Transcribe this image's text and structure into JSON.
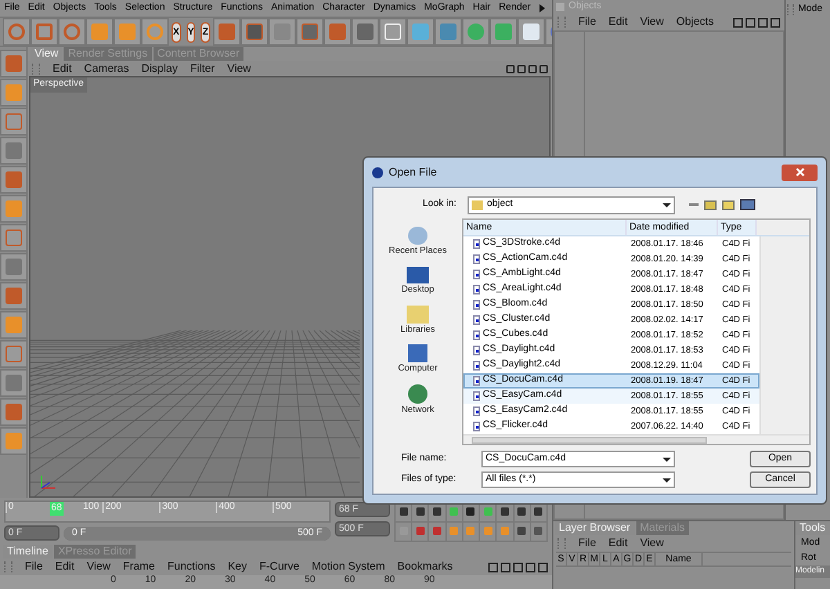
{
  "menubar": [
    "File",
    "Edit",
    "Objects",
    "Tools",
    "Selection",
    "Structure",
    "Functions",
    "Animation",
    "Character",
    "Dynamics",
    "MoGraph",
    "Hair",
    "Render"
  ],
  "axis_buttons": [
    "X",
    "Y",
    "Z"
  ],
  "view_tabs": [
    {
      "label": "View",
      "selected": true
    },
    {
      "label": "Render Settings",
      "selected": false
    },
    {
      "label": "Content Browser",
      "selected": false
    }
  ],
  "view_menu": [
    "Edit",
    "Cameras",
    "Display",
    "Filter",
    "View"
  ],
  "viewport_label": "Perspective",
  "objects_panel": {
    "title": "Objects",
    "menu": [
      "File",
      "Edit",
      "View",
      "Objects"
    ]
  },
  "attributes_panel": {
    "mode": "Mode"
  },
  "timeline_ruler": {
    "ticks": [
      "0",
      "100",
      "200",
      "300",
      "400",
      "500"
    ],
    "current": "68"
  },
  "range_slider": {
    "level": 1
  },
  "current_frame": "68 F",
  "start_frame": "0 F",
  "range_start": "0 F",
  "range_end": "500 F",
  "end_frame": "500 F",
  "bottom_tabs": [
    {
      "label": "Timeline",
      "selected": true
    },
    {
      "label": "XPresso Editor",
      "selected": false
    }
  ],
  "timeline_menu": [
    "File",
    "Edit",
    "View",
    "Frame",
    "Functions",
    "Key",
    "F-Curve",
    "Motion System",
    "Bookmarks"
  ],
  "timeline_ticks": [
    "0",
    "10",
    "20",
    "30",
    "40",
    "50",
    "60",
    "80",
    "90"
  ],
  "layer_browser": {
    "tabs": [
      {
        "label": "Layer Browser",
        "selected": true
      },
      {
        "label": "Materials",
        "selected": false
      }
    ],
    "menu": [
      "File",
      "Edit",
      "View"
    ],
    "columns": [
      "S",
      "V",
      "R",
      "M",
      "L",
      "A",
      "G",
      "D",
      "E",
      "Name"
    ]
  },
  "tools_panel": {
    "tabs": [
      {
        "label": "Tools",
        "selected": true
      }
    ],
    "items": [
      "Mod",
      "Rot"
    ],
    "section": "Modelin"
  },
  "dialog": {
    "title": "Open File",
    "look_in_label": "Look in:",
    "look_in": "object",
    "places": [
      "Recent Places",
      "Desktop",
      "Libraries",
      "Computer",
      "Network"
    ],
    "columns": [
      "Name",
      "Date modified",
      "Type"
    ],
    "files": [
      {
        "name": "CS_3DStroke.c4d",
        "date": "2008.01.17. 18:46",
        "type": "C4D Fi",
        "selected": false,
        "hovered": false
      },
      {
        "name": "CS_ActionCam.c4d",
        "date": "2008.01.20. 14:39",
        "type": "C4D Fi",
        "selected": false,
        "hovered": false
      },
      {
        "name": "CS_AmbLight.c4d",
        "date": "2008.01.17. 18:47",
        "type": "C4D Fi",
        "selected": false,
        "hovered": false
      },
      {
        "name": "CS_AreaLight.c4d",
        "date": "2008.01.17. 18:48",
        "type": "C4D Fi",
        "selected": false,
        "hovered": false
      },
      {
        "name": "CS_Bloom.c4d",
        "date": "2008.01.17. 18:50",
        "type": "C4D Fi",
        "selected": false,
        "hovered": false
      },
      {
        "name": "CS_Cluster.c4d",
        "date": "2008.02.02. 14:17",
        "type": "C4D Fi",
        "selected": false,
        "hovered": false
      },
      {
        "name": "CS_Cubes.c4d",
        "date": "2008.01.17. 18:52",
        "type": "C4D Fi",
        "selected": false,
        "hovered": false
      },
      {
        "name": "CS_Daylight.c4d",
        "date": "2008.01.17. 18:53",
        "type": "C4D Fi",
        "selected": false,
        "hovered": false
      },
      {
        "name": "CS_Daylight2.c4d",
        "date": "2008.12.29. 11:04",
        "type": "C4D Fi",
        "selected": false,
        "hovered": false
      },
      {
        "name": "CS_DocuCam.c4d",
        "date": "2008.01.19. 18:47",
        "type": "C4D Fi",
        "selected": true,
        "hovered": false
      },
      {
        "name": "CS_EasyCam.c4d",
        "date": "2008.01.17. 18:55",
        "type": "C4D Fi",
        "selected": false,
        "hovered": true
      },
      {
        "name": "CS_EasyCam2.c4d",
        "date": "2008.01.17. 18:55",
        "type": "C4D Fi",
        "selected": false,
        "hovered": false
      },
      {
        "name": "CS_Flicker.c4d",
        "date": "2007.06.22. 14:40",
        "type": "C4D Fi",
        "selected": false,
        "hovered": false
      }
    ],
    "file_name_label": "File name:",
    "file_name": "CS_DocuCam.c4d",
    "file_type_label": "Files of type:",
    "file_type": "All files (*.*)",
    "buttons": [
      "Open",
      "Cancel"
    ]
  }
}
